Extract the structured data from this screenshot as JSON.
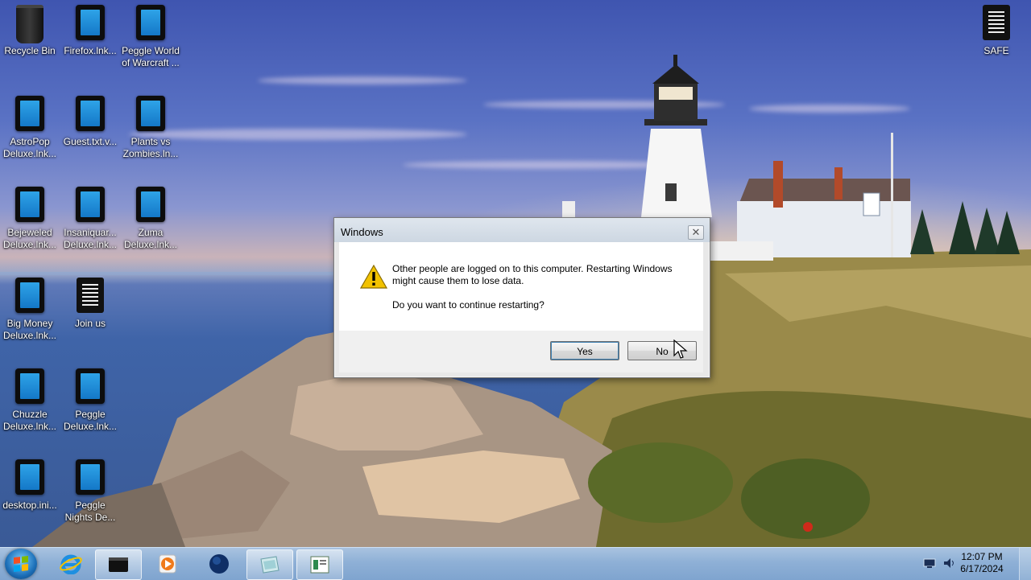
{
  "desktop": {
    "icons": [
      {
        "label": "Recycle Bin",
        "icon": "recycle-bin-icon"
      },
      {
        "label": "Firefox.lnk...",
        "icon": "shortcut-icon"
      },
      {
        "label": "Peggle World of Warcraft ...",
        "icon": "shortcut-icon"
      },
      {
        "label": "AstroPop Deluxe.lnk...",
        "icon": "shortcut-icon"
      },
      {
        "label": "Guest.txt.v...",
        "icon": "shortcut-icon"
      },
      {
        "label": "Plants vs Zombies.ln...",
        "icon": "shortcut-icon"
      },
      {
        "label": "Bejeweled Deluxe.lnk...",
        "icon": "shortcut-icon"
      },
      {
        "label": "Insaniquar... Deluxe.lnk...",
        "icon": "shortcut-icon"
      },
      {
        "label": "Zuma Deluxe.lnk...",
        "icon": "shortcut-icon"
      },
      {
        "label": "Big Money Deluxe.lnk...",
        "icon": "shortcut-icon"
      },
      {
        "label": "Join us",
        "icon": "text-document-icon"
      },
      {
        "label": "Chuzzle Deluxe.lnk...",
        "icon": "shortcut-icon"
      },
      {
        "label": "Peggle Deluxe.lnk...",
        "icon": "shortcut-icon"
      },
      {
        "label": "desktop.ini...",
        "icon": "shortcut-icon"
      },
      {
        "label": "Peggle Nights De...",
        "icon": "shortcut-icon"
      },
      {
        "label": "SAFE",
        "icon": "text-document-icon"
      }
    ]
  },
  "dialog": {
    "title": "Windows",
    "close_glyph": "✕",
    "message": "Other people are logged on to this computer. Restarting Windows might cause them to lose data.",
    "question": "Do you want to continue restarting?",
    "yes_label": "Yes",
    "no_label": "No"
  },
  "taskbar": {
    "items": [
      "start-button",
      "internet-explorer",
      "terminal",
      "media-player",
      "globe-app",
      "folder",
      "notepad"
    ],
    "clock_time": "12:07 PM",
    "clock_date": "6/17/2024"
  },
  "colors": {
    "taskbar": "#8eb0d6",
    "dialog_bg": "#f0f0f0",
    "warning": "#f2c200"
  }
}
